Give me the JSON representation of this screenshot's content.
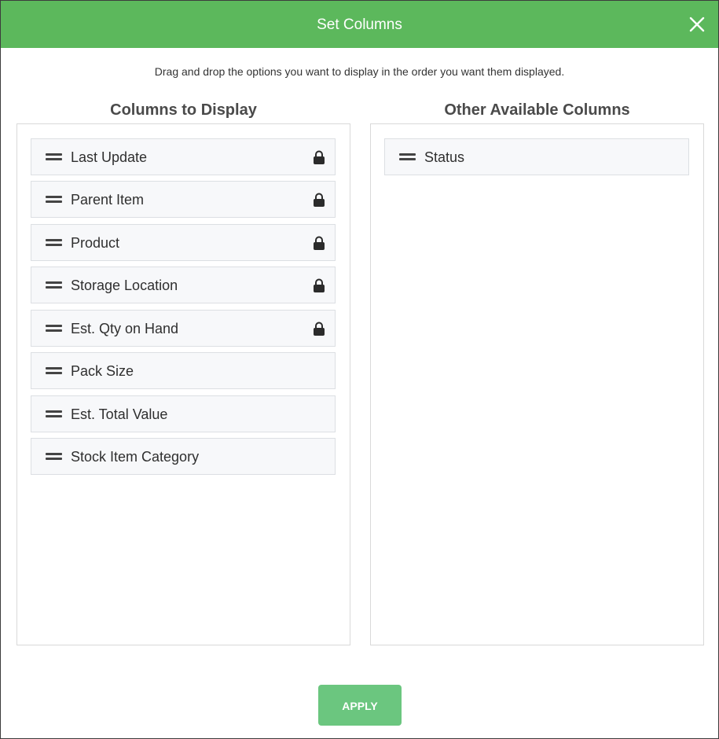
{
  "dialog": {
    "title": "Set Columns",
    "close_icon": "close-icon",
    "instructions": "Drag and drop the options you want to display in the order you want them displayed.",
    "apply_label": "APPLY",
    "colors": {
      "header": "#5cb85c",
      "apply_button": "#6bc67f"
    }
  },
  "columns_to_display": {
    "title": "Columns to Display",
    "items": [
      {
        "label": "Last Update",
        "locked": true
      },
      {
        "label": "Parent Item",
        "locked": true
      },
      {
        "label": "Product",
        "locked": true
      },
      {
        "label": "Storage Location",
        "locked": true
      },
      {
        "label": "Est. Qty on Hand",
        "locked": true
      },
      {
        "label": "Pack Size",
        "locked": false
      },
      {
        "label": "Est. Total Value",
        "locked": false
      },
      {
        "label": "Stock Item Category",
        "locked": false
      }
    ]
  },
  "other_columns": {
    "title": "Other Available Columns",
    "items": [
      {
        "label": "Status",
        "locked": false
      }
    ]
  }
}
